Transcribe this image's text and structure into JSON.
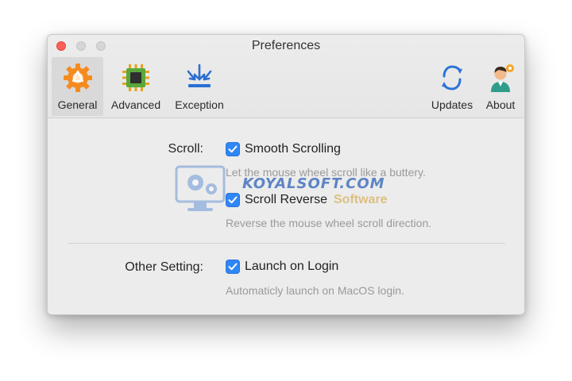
{
  "window": {
    "title": "Preferences"
  },
  "toolbar": {
    "tabs": [
      {
        "label": "General",
        "icon": "gear-icon",
        "selected": true
      },
      {
        "label": "Advanced",
        "icon": "chip-icon",
        "selected": false
      },
      {
        "label": "Exception",
        "icon": "download-arrows-icon",
        "selected": false
      },
      {
        "label": "Updates",
        "icon": "refresh-icon",
        "selected": false
      },
      {
        "label": "About",
        "icon": "person-icon",
        "selected": false
      }
    ]
  },
  "scroll": {
    "label": "Scroll:",
    "options": [
      {
        "label": "Smooth Scrolling",
        "checked": true,
        "description": "Let the mouse wheel scroll like a buttery."
      },
      {
        "label": "Scroll Reverse",
        "checked": true,
        "description": "Reverse the mouse wheel scroll direction."
      }
    ]
  },
  "other": {
    "label": "Other Setting:",
    "options": [
      {
        "label": "Launch on Login",
        "checked": true,
        "description": "Automaticly launch on MacOS login."
      }
    ]
  },
  "watermark": {
    "text": "KOYALSOFT.COM",
    "subtext": "Software"
  },
  "colors": {
    "accent": "#2f86f6",
    "close": "#fc5f57",
    "general_icon": "#f58b1f",
    "advanced_icon": "#5aa83a",
    "exception_icon": "#2b6fd1"
  }
}
